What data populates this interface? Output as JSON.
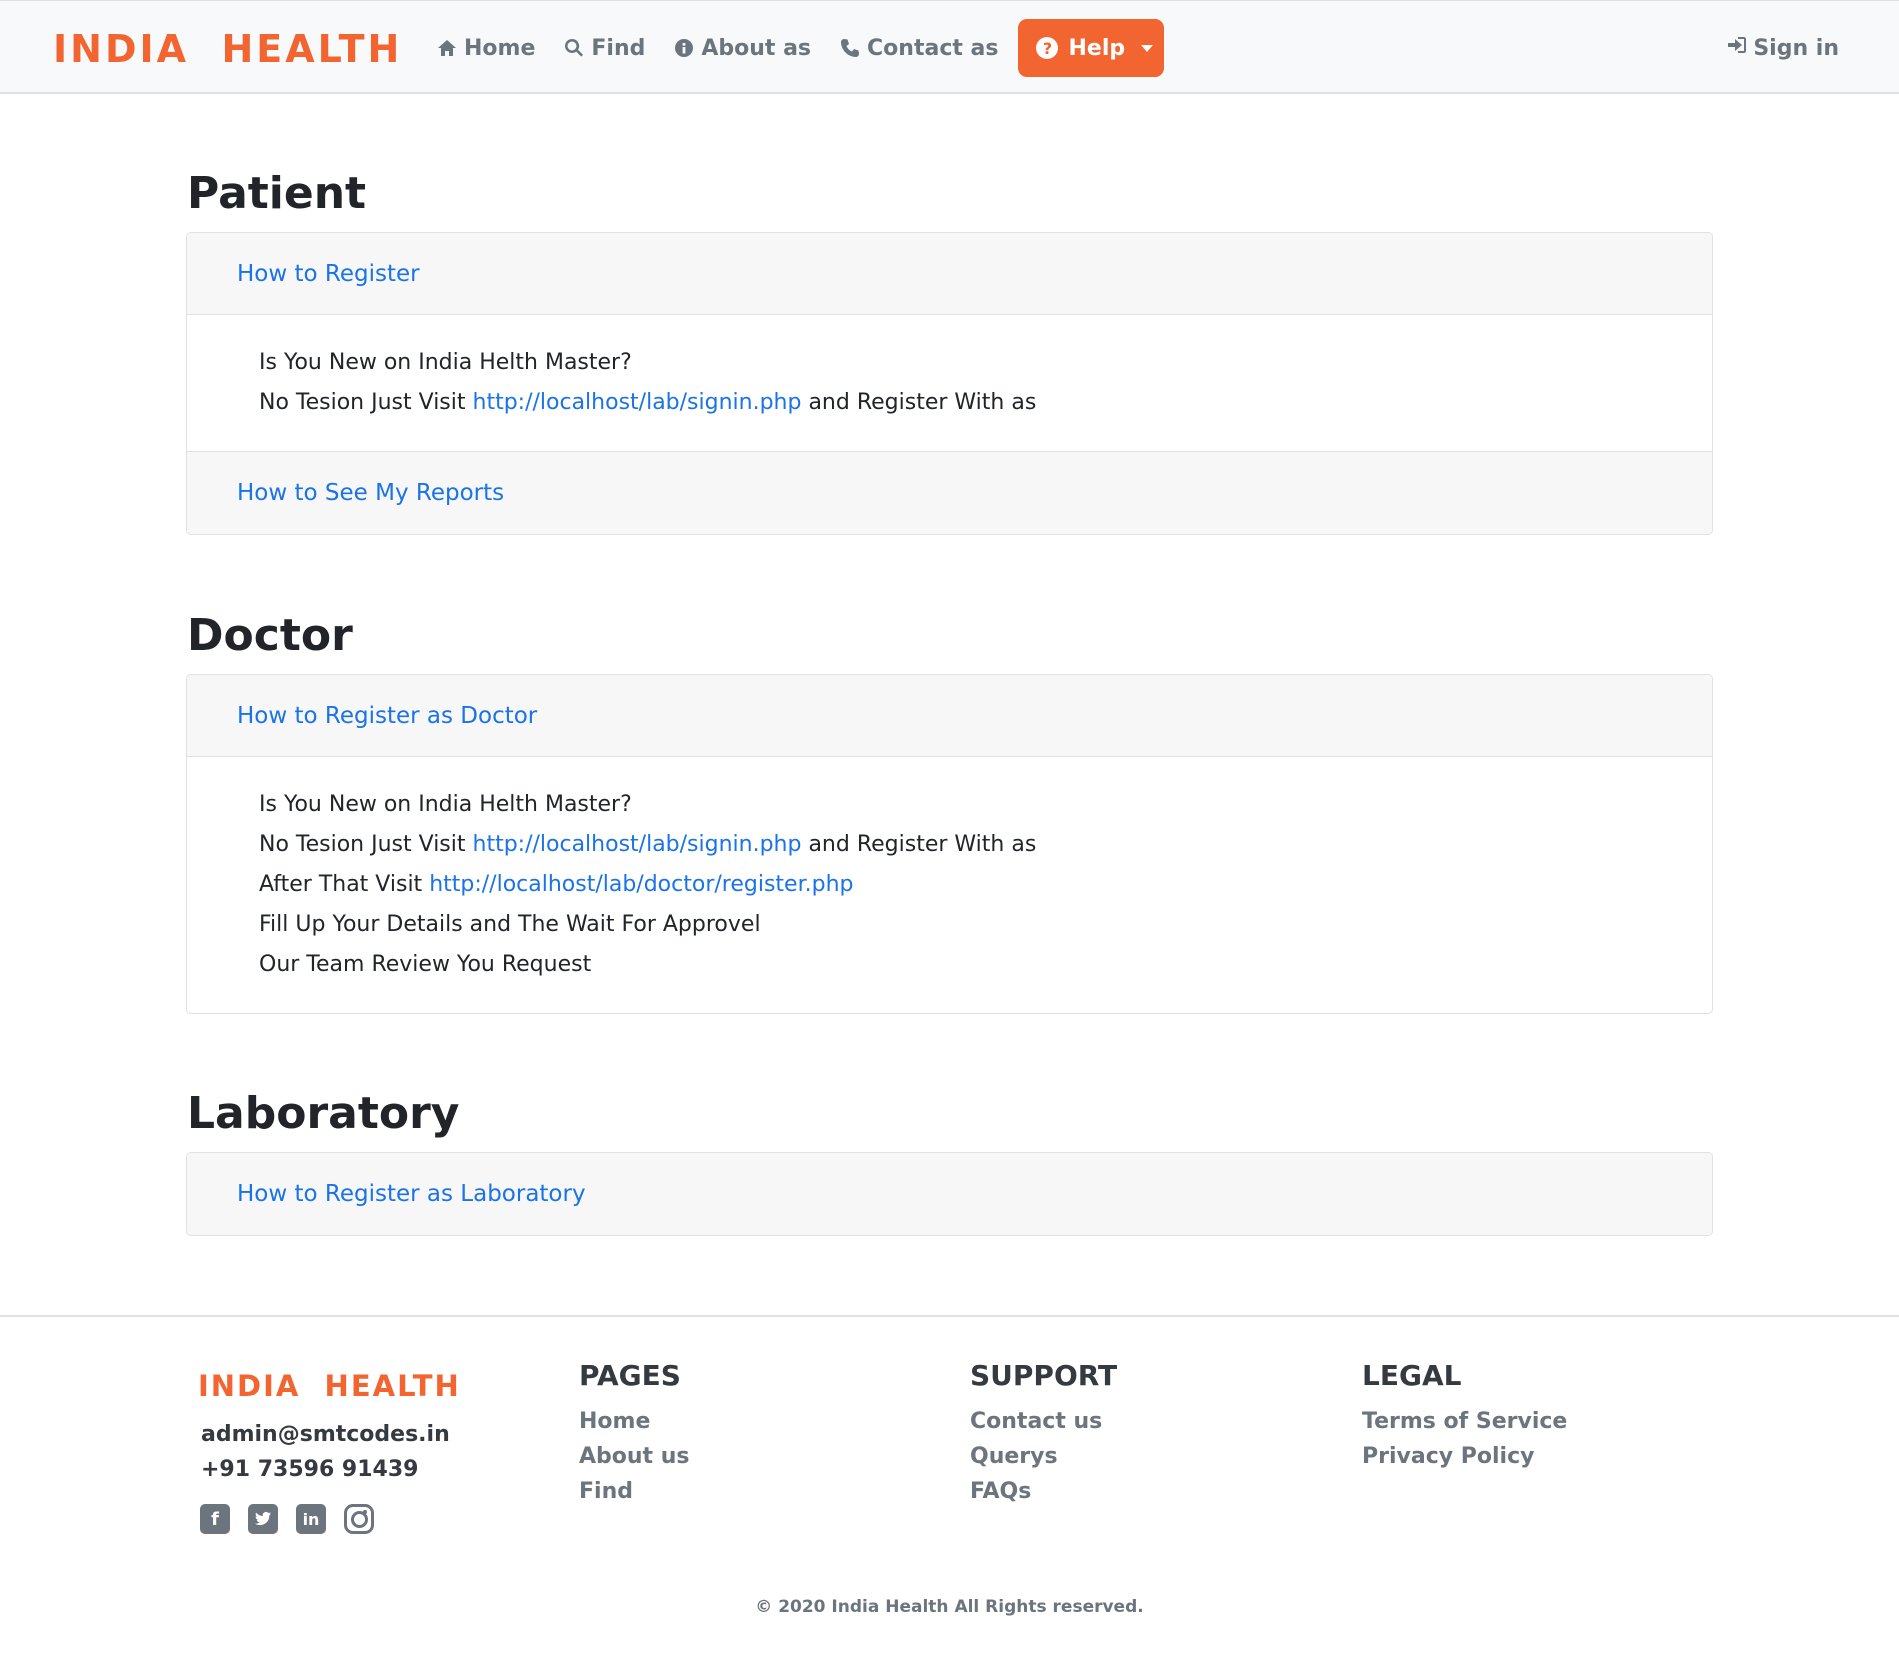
{
  "brand": "INDIA  HEALTH",
  "nav": {
    "home": "Home",
    "find": "Find",
    "about": "About as",
    "contact": "Contact as",
    "help": "Help",
    "signin": "Sign in"
  },
  "sections": {
    "patient": {
      "title": "Patient",
      "item1": "How to Register",
      "body": {
        "line1": "Is You New on India Helth Master?",
        "line2_prefix": "No Tesion Just Visit ",
        "line2_link": "http://localhost/lab/signin.php",
        "line2_suffix": " and Register With as"
      },
      "item2": "How to See My Reports"
    },
    "doctor": {
      "title": "Doctor",
      "item1": "How to Register as Doctor",
      "body": {
        "line1": "Is You New on India Helth Master?",
        "line2_prefix": "No Tesion Just Visit ",
        "line2_link": "http://localhost/lab/signin.php",
        "line2_suffix": " and Register With as",
        "line3_prefix": "After That Visit ",
        "line3_link": "http://localhost/lab/doctor/register.php",
        "line4": "Fill Up Your Details and The Wait For Approvel",
        "line5": "Our Team Review You Request"
      }
    },
    "laboratory": {
      "title": "Laboratory",
      "item1": "How to Register as Laboratory"
    }
  },
  "footer": {
    "brand": "INDIA  HEALTH",
    "email": "admin@smtcodes.in",
    "phone": "+91 73596 91439",
    "socials": [
      "facebook-icon",
      "twitter-icon",
      "linkedin-icon",
      "instagram-icon"
    ],
    "pages": {
      "title": "PAGES",
      "links": [
        "Home",
        "About us",
        "Find"
      ]
    },
    "support": {
      "title": "SUPPORT",
      "links": [
        "Contact us",
        "Querys",
        "FAQs"
      ]
    },
    "legal": {
      "title": "LEGAL",
      "links": [
        "Terms of Service",
        "Privacy Policy"
      ]
    },
    "copyright": "© 2020 India Health All Rights reserved."
  },
  "colors": {
    "brand": "#f26430",
    "link": "#1a73e8",
    "muted": "#6c757d"
  }
}
